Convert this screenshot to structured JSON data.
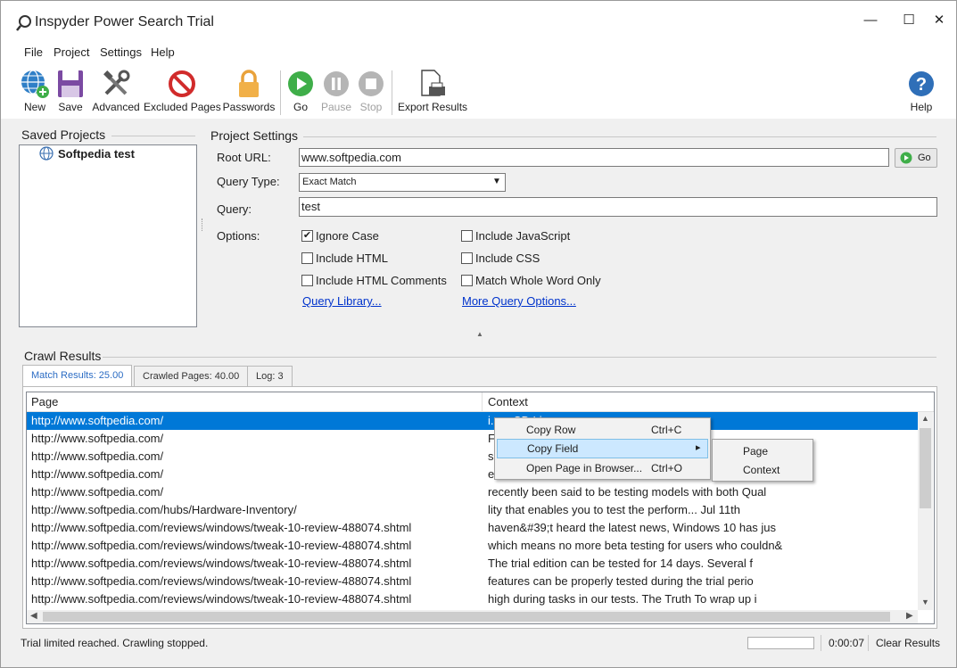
{
  "window": {
    "title": "Inspyder Power Search Trial",
    "minimize": "—",
    "maximize": "☐",
    "close": "✕"
  },
  "menu": {
    "items": [
      "File",
      "Project",
      "Settings",
      "Help"
    ]
  },
  "toolbar": {
    "new": "New",
    "save": "Save",
    "advanced": "Advanced",
    "excluded": "Excluded Pages",
    "passwords": "Passwords",
    "go": "Go",
    "pause": "Pause",
    "stop": "Stop",
    "export": "Export Results",
    "help": "Help"
  },
  "saved_projects": {
    "title": "Saved Projects",
    "items": [
      "Softpedia test"
    ]
  },
  "settings": {
    "title": "Project Settings",
    "root_url_label": "Root URL:",
    "root_url": "www.softpedia.com",
    "go": "Go",
    "query_type_label": "Query Type:",
    "query_type": "Exact Match",
    "query_label": "Query:",
    "query": "test",
    "options_label": "Options:",
    "options": [
      {
        "label": "Ignore Case",
        "checked": true
      },
      {
        "label": "Include JavaScript",
        "checked": false
      },
      {
        "label": "Include HTML",
        "checked": false
      },
      {
        "label": "Include CSS",
        "checked": false
      },
      {
        "label": "Include HTML Comments",
        "checked": false
      },
      {
        "label": "Match Whole Word Only",
        "checked": false
      }
    ],
    "query_library": "Query Library...",
    "more_options": "More Query Options..."
  },
  "crawl": {
    "title": "Crawl Results",
    "tabs": [
      "Match Results: 25.00",
      "Crawled Pages: 40.00",
      "Log: 3"
    ],
    "columns": [
      "Page",
      "Context"
    ],
    "rows": [
      {
        "page": "http://www.softpedia.com/",
        "context": "i...  ...CD Linux o"
      },
      {
        "page": "http://www.softpedia.com/",
        "context": "F"
      },
      {
        "page": "http://www.softpedia.com/",
        "context": "s"
      },
      {
        "page": "http://www.softpedia.com/",
        "context": "e"
      },
      {
        "page": "http://www.softpedia.com/",
        "context": "recently been said to be testing models with both Qual"
      },
      {
        "page": "http://www.softpedia.com/hubs/Hardware-Inventory/",
        "context": "lity that enables you to test the perform... Jul 11th"
      },
      {
        "page": "http://www.softpedia.com/reviews/windows/tweak-10-review-488074.shtml",
        "context": "haven&#39;t heard the latest news, Windows 10 has jus"
      },
      {
        "page": "http://www.softpedia.com/reviews/windows/tweak-10-review-488074.shtml",
        "context": "which means no more beta testing for users who couldn&"
      },
      {
        "page": "http://www.softpedia.com/reviews/windows/tweak-10-review-488074.shtml",
        "context": "The trial edition can be tested for 14 days. Several f"
      },
      {
        "page": "http://www.softpedia.com/reviews/windows/tweak-10-review-488074.shtml",
        "context": "features can be properly tested during the trial perio"
      },
      {
        "page": "http://www.softpedia.com/reviews/windows/tweak-10-review-488074.shtml",
        "context": "high during tasks in our tests. The Truth To wrap up i"
      }
    ]
  },
  "context_menu": {
    "items": [
      {
        "label": "Copy Row",
        "shortcut": "Ctrl+C"
      },
      {
        "label": "Copy Field",
        "shortcut": "▸"
      },
      {
        "label": "Open Page in Browser...",
        "shortcut": "Ctrl+O"
      }
    ],
    "submenu": [
      "Page",
      "Context"
    ]
  },
  "status": {
    "message": "Trial limited reached. Crawling stopped.",
    "elapsed": "0:00:07",
    "clear": "Clear Results",
    "progress": 0
  }
}
